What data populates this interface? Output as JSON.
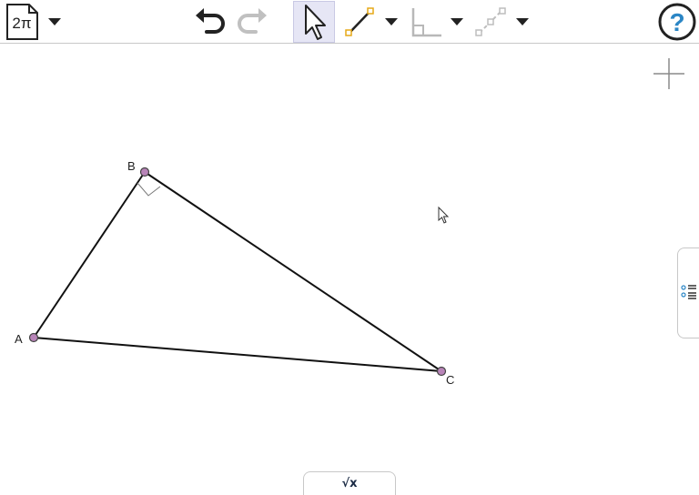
{
  "toolbar": {
    "document_label": "2π",
    "help_label": "?"
  },
  "canvas": {
    "points": [
      {
        "name": "A"
      },
      {
        "name": "B"
      },
      {
        "name": "C"
      }
    ]
  },
  "math_tab": {
    "label": "√x"
  },
  "colors": {
    "accent": "#2b86c5",
    "point_fill": "#b884b8",
    "selected_tool_bg": "#e6e6f5",
    "segment_handle": "#e6a817"
  }
}
